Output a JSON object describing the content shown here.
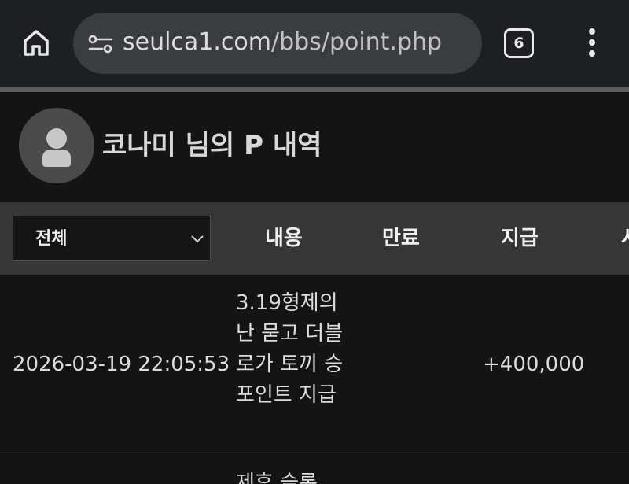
{
  "browser": {
    "url_domain": "seulca1.com",
    "url_path": "/bbs/point.php",
    "tab_count": "6",
    "icons": [
      "home-icon",
      "site-settings-icon",
      "tabs-icon",
      "more-vert-icon"
    ]
  },
  "header": {
    "title": "코나미 님의 P 내역",
    "avatar_icon": "user-avatar-icon"
  },
  "table": {
    "filter": {
      "selected": "전체",
      "icon": "chevron-down-icon"
    },
    "columns": [
      "내용",
      "만료",
      "지급",
      "사"
    ],
    "rows": [
      {
        "date": "2026-03-19 22:05:53",
        "content": "3.19형제의난 묻고 더블로가 토끼 승 포인트 지급",
        "expiry": "",
        "amount": "+400,000"
      },
      {
        "content": "제휴 슬롯"
      }
    ]
  },
  "colors": {
    "chrome_bg": "#1d1f22",
    "url_pill": "#3a3c40",
    "page_bg": "#141414",
    "table_header_bg": "#363636",
    "divider": "#5a5a5a"
  }
}
